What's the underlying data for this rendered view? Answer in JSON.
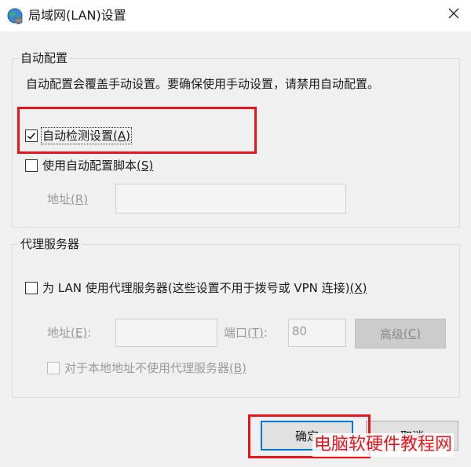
{
  "window": {
    "title": "局域网(LAN)设置"
  },
  "auto_config": {
    "group_label": "自动配置",
    "description": "自动配置会覆盖手动设置。要确保使用手动设置，请禁用自动配置。",
    "auto_detect": {
      "label": "自动检测设置",
      "mnemonic": "(A)",
      "checked": true
    },
    "use_script": {
      "label": "使用自动配置脚本",
      "mnemonic": "(S)",
      "checked": false
    },
    "address": {
      "label": "地址",
      "mnemonic": "(R)",
      "value": ""
    }
  },
  "proxy": {
    "group_label": "代理服务器",
    "use_proxy": {
      "label": "为 LAN 使用代理服务器(这些设置不用于拨号或 VPN 连接)",
      "mnemonic": "(X)",
      "checked": false
    },
    "address": {
      "label": "地址",
      "mnemonic": "(E)",
      "colon": ":",
      "value": ""
    },
    "port": {
      "label": "端口",
      "mnemonic": "(T)",
      "colon": ":",
      "value": "80"
    },
    "advanced_button": {
      "label": "高级",
      "mnemonic": "(C)"
    },
    "bypass_local": {
      "label": "对于本地地址不使用代理服务器",
      "mnemonic": "(B)",
      "checked": false
    }
  },
  "buttons": {
    "ok": "确定",
    "cancel": "取消"
  },
  "watermark": "电脑软硬件教程网",
  "colors": {
    "highlight": "#e8141b",
    "default_button_border": "#0078d7"
  },
  "icons": {
    "window": "globe-network-icon",
    "close": "close-icon",
    "check": "checkmark-icon"
  }
}
